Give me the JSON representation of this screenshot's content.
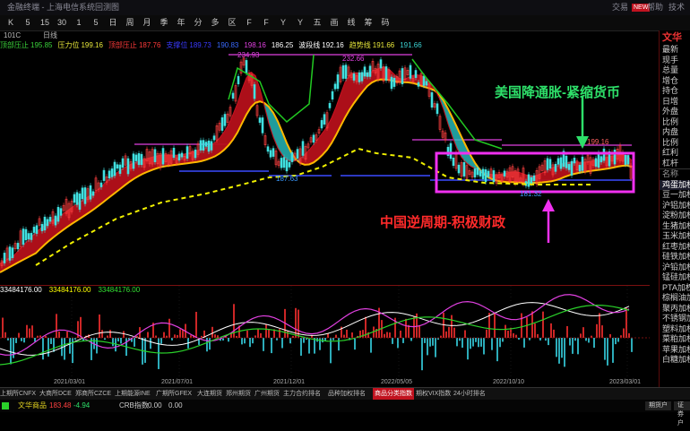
{
  "window": {
    "title": "金融终端 - 上海电信",
    "subtitle": "系统回测图",
    "right_buttons": [
      "交易",
      "帮助",
      "技术"
    ]
  },
  "toolbar": {
    "items": [
      "K",
      "5",
      "15",
      "30",
      "1",
      "5",
      "日",
      "周",
      "月",
      "季",
      "年",
      "分",
      "多",
      "区",
      "F",
      "F",
      "Y",
      "Y",
      "五",
      "画",
      "线",
      "筹",
      "码"
    ]
  },
  "period_bar": {
    "symbol": "101C",
    "period": "日线"
  },
  "legend": [
    {
      "label": "顶部压止",
      "value": "195.85",
      "color": "#3ad13a"
    },
    {
      "label": "压力位",
      "value": "199.16",
      "color": "#e8e83a"
    },
    {
      "label": "顶部压止",
      "value": "187.76",
      "color": "#ff3a3a"
    },
    {
      "label": "支撑位",
      "value": "189.73",
      "color": "#3a3aff"
    },
    {
      "label": "",
      "value": "190.83",
      "color": "#3a6aff"
    },
    {
      "label": "",
      "value": "198.16",
      "color": "#e040e0"
    },
    {
      "label": "",
      "value": "186.25",
      "color": "#ffffff"
    },
    {
      "label": "波段线",
      "value": "192.16",
      "color": "#ffffff"
    },
    {
      "label": "趋势线",
      "value": "191.66",
      "color": "#e8e83a"
    },
    {
      "label": "",
      "value": "191.66",
      "color": "#3ad1d1"
    }
  ],
  "price_labels": {
    "p1": "234.93",
    "p2": "232.66",
    "low1": "187.63",
    "low2": "181.32",
    "high3": "199.16"
  },
  "annotations": {
    "us": "美国降通胀-紧缩货币",
    "cn": "中国逆周期-积极财政"
  },
  "sub_legend": [
    {
      "value": "33484176.00",
      "color": "#ffffff"
    },
    {
      "value": "33484176.00",
      "color": "#ffff00"
    },
    {
      "value": "33484176.00",
      "color": "#33e033"
    }
  ],
  "x_dates": [
    "2021/03/01",
    "2021/07/01",
    "2021/12/01",
    "2022/05/05",
    "2022/10/10",
    "2023/03/01"
  ],
  "right_panel": {
    "title": "文华",
    "info_rows": [
      "最新",
      "现手",
      "总量",
      "增仓",
      "持仓",
      "日增",
      "外盘",
      "比例",
      "内盘",
      "比例",
      "红利",
      "杠杆"
    ],
    "section": "名称",
    "list": [
      "鸡蛋加权",
      "豆一加权",
      "沪铝加权",
      "淀粉加权",
      "生猪加权",
      "玉米加权",
      "红枣加权",
      "硅铁加权",
      "沪铅加权",
      "锰硅加权",
      "PTA加权",
      "棕榈油加权",
      "聚丙加权",
      "不锈钢加权",
      "塑料加权",
      "菜粕加权",
      "苹果加权",
      "白糖加权"
    ]
  },
  "tabs": [
    "上期所CNFX",
    "大商所DCE",
    "郑商所CZCE",
    "上期能源INE",
    "广期所GFEX",
    "大连期货",
    "郑州期货",
    "广州期货",
    "主力合约排名",
    "品种加权排名",
    "商品分类指数",
    "期权VIX指数",
    "24小时排名"
  ],
  "active_tab": "商品分类指数",
  "status": {
    "item1": "文华商品",
    "value1": "183.48",
    "change1": "-4.94",
    "item2": "CRB指数",
    "value2": "0.00",
    "change2": "0.00",
    "buttons": [
      "期货户",
      "证券户"
    ]
  },
  "chart_data": {
    "type": "candlestick",
    "x_ticks": [
      "2021/03/01",
      "2021/07/01",
      "2021/12/01",
      "2022/05/05",
      "2022/10/10",
      "2023/03/01"
    ],
    "ylim": [
      150,
      240
    ],
    "close_approx": [
      {
        "x": "2020/11",
        "y": 152
      },
      {
        "x": "2021/03",
        "y": 185
      },
      {
        "x": "2021/05",
        "y": 213
      },
      {
        "x": "2021/07",
        "y": 212
      },
      {
        "x": "2021/10",
        "y": 234.93
      },
      {
        "x": "2021/12",
        "y": 187.63
      },
      {
        "x": "2022/03",
        "y": 232.66
      },
      {
        "x": "2022/06",
        "y": 225
      },
      {
        "x": "2022/07",
        "y": 195
      },
      {
        "x": "2022/10",
        "y": 181.32
      },
      {
        "x": "2023/01",
        "y": 199.16
      },
      {
        "x": "2023/03",
        "y": 183.48
      }
    ]
  }
}
